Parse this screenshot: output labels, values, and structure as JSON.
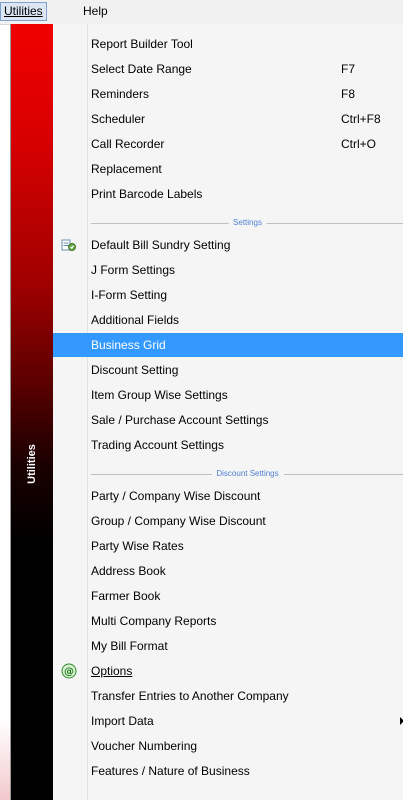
{
  "menubar": {
    "utilities": "Utilities",
    "help": "Help"
  },
  "strip_label": "Utilities",
  "items_a": [
    {
      "label": "Report Builder Tool",
      "shortcut": ""
    },
    {
      "label": "Select Date Range",
      "shortcut": "F7"
    },
    {
      "label": "Reminders",
      "shortcut": "F8"
    },
    {
      "label": "Scheduler",
      "shortcut": "Ctrl+F8"
    },
    {
      "label": "Call Recorder",
      "shortcut": "Ctrl+O"
    },
    {
      "label": "Replacement",
      "shortcut": ""
    },
    {
      "label": "Print Barcode Labels",
      "shortcut": ""
    }
  ],
  "sep_settings": "Settings",
  "items_b": [
    {
      "label": "Default Bill Sundry Setting",
      "icon": "bill-sundry-icon"
    },
    {
      "label": "J Form Settings"
    },
    {
      "label": "I-Form Setting"
    },
    {
      "label": "Additional Fields"
    },
    {
      "label": "Business Grid",
      "highlighted": true
    },
    {
      "label": "Discount Setting"
    },
    {
      "label": "Item Group Wise Settings"
    },
    {
      "label": "Sale / Purchase Account Settings"
    },
    {
      "label": "Trading Account Settings"
    }
  ],
  "sep_discount": "Discount Settings",
  "items_c": [
    {
      "label": "Party / Company Wise Discount"
    },
    {
      "label": "Group / Company Wise Discount"
    },
    {
      "label": "Party Wise Rates"
    },
    {
      "label": "Address Book"
    },
    {
      "label": "Farmer Book"
    },
    {
      "label": "Multi Company Reports"
    },
    {
      "label": "My Bill Format"
    },
    {
      "label": "Options",
      "icon": "options-at-icon"
    },
    {
      "label": "Transfer Entries to Another Company"
    },
    {
      "label": "Import Data",
      "submenu": true
    },
    {
      "label": "Voucher Numbering"
    },
    {
      "label": "Features / Nature of Business"
    }
  ],
  "colors": {
    "highlight": "#3399ff",
    "separator_text": "#4d7fd1",
    "strip_top": "#f00000",
    "strip_bottom": "#000000"
  }
}
